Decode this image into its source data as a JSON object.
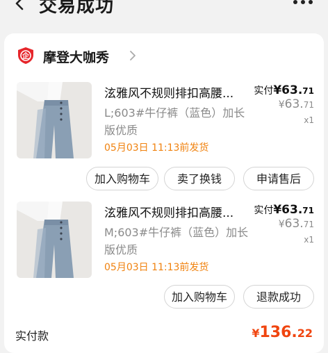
{
  "header": {
    "title": "交易成功"
  },
  "shop": {
    "name": "摩登大咖秀"
  },
  "items": [
    {
      "title": "泫雅风不规则排扣高腰...",
      "spec": "L;603#牛仔裤（蓝色）加长版优质",
      "ship": "05月03日 11:13前发货",
      "paid_label": "实付",
      "paid_yen": "¥",
      "paid_int": "63.",
      "paid_dec": "71",
      "orig_yen": "¥",
      "orig_int": "63.",
      "orig_dec": "71",
      "qty": "x1",
      "buttons": [
        "加入购物车",
        "卖了换钱",
        "申请售后"
      ]
    },
    {
      "title": "泫雅风不规则排扣高腰...",
      "spec": "M;603#牛仔裤（蓝色）加长版优质",
      "ship": "05月03日 11:13前发货",
      "paid_label": "实付",
      "paid_yen": "¥",
      "paid_int": "63.",
      "paid_dec": "71",
      "orig_yen": "¥",
      "orig_int": "63.",
      "orig_dec": "71",
      "qty": "x1",
      "buttons": [
        "加入购物车",
        "退款成功"
      ]
    }
  ],
  "total": {
    "label": "实付款",
    "currency": "¥",
    "int": "136.",
    "dec": "22"
  },
  "colors": {
    "accent": "#f0450f",
    "ship": "#f0820f",
    "background": "#f2f2f2",
    "shop_logo": "#e6262b"
  }
}
